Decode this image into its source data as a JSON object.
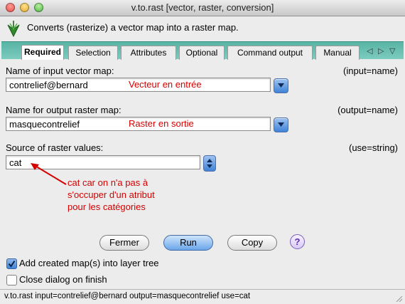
{
  "window": {
    "title": "v.to.rast [vector, raster, conversion]"
  },
  "header": {
    "description": "Converts (rasterize) a vector map into a raster map."
  },
  "tabs": [
    {
      "label": "Required",
      "active": true
    },
    {
      "label": "Selection"
    },
    {
      "label": "Attributes"
    },
    {
      "label": "Optional"
    },
    {
      "label": "Command output"
    },
    {
      "label": "Manual"
    }
  ],
  "tab_nav": {
    "left": "◁",
    "right": "▷",
    "down": "▽"
  },
  "form": {
    "input": {
      "label": "Name of input vector map:",
      "param": "(input=name)",
      "value": "contrelief@bernard",
      "note": "Vecteur en entrée"
    },
    "output": {
      "label": "Name for output raster map:",
      "param": "(output=name)",
      "value": "masquecontrelief",
      "note": "Raster en sortie"
    },
    "use": {
      "label": "Source of raster values:",
      "param": "(use=string)",
      "value": "cat"
    }
  },
  "annotation": {
    "lines": [
      "cat car on n'a pas à",
      "s'occuper d'un atribut",
      "pour les catégories"
    ],
    "color": "#d40000"
  },
  "buttons": {
    "close": "Fermer",
    "run": "Run",
    "copy": "Copy",
    "help": "?"
  },
  "options": {
    "add_layer": {
      "label": "Add created map(s) into layer tree",
      "checked": true
    },
    "close_dialog": {
      "label": "Close dialog on finish",
      "checked": false
    }
  },
  "status": {
    "command": "v.to.rast input=contrelief@bernard output=masquecontrelief use=cat"
  }
}
